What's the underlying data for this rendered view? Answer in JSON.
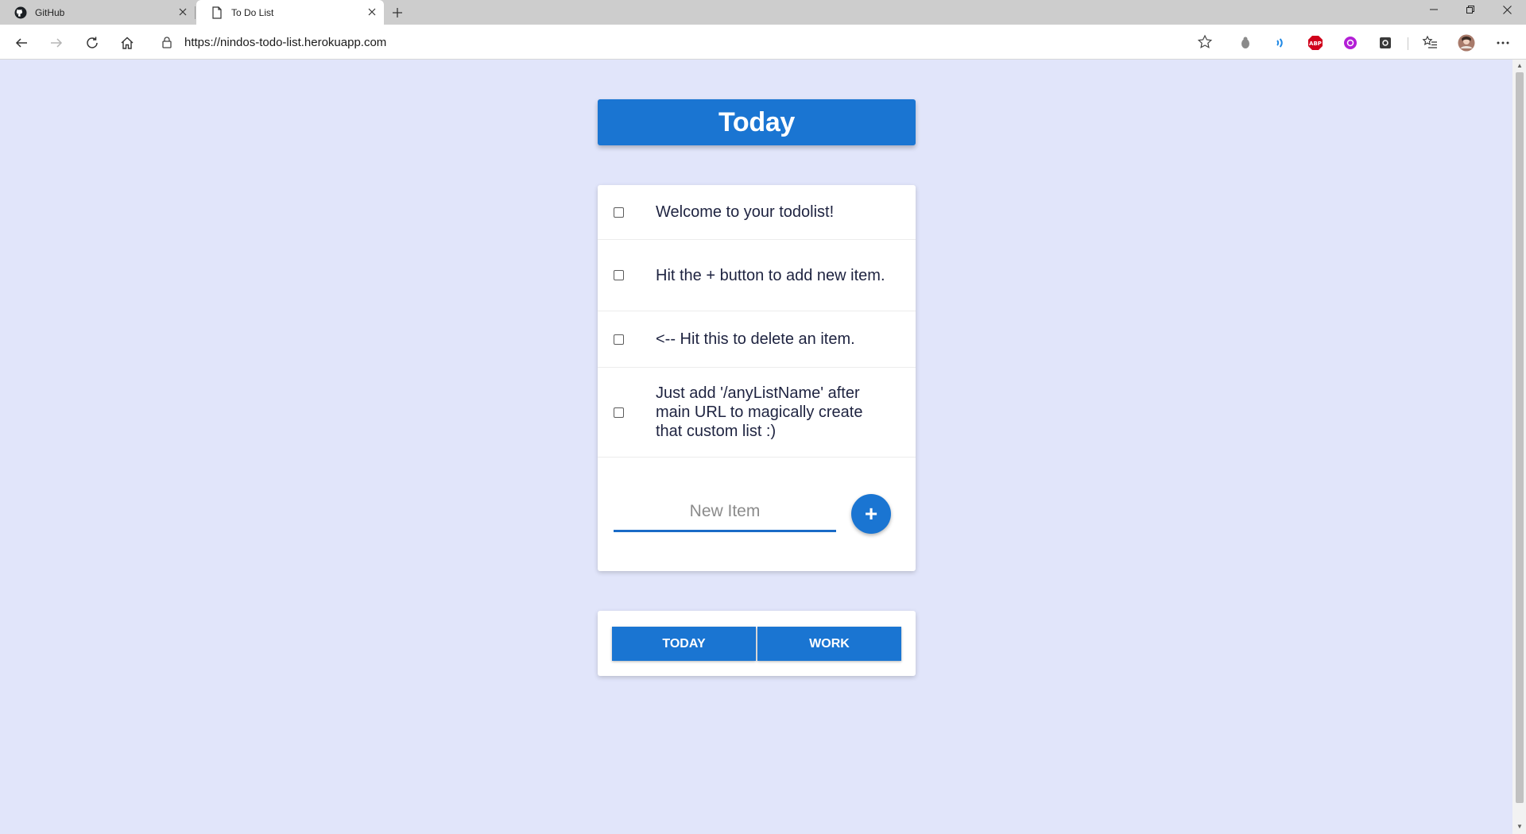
{
  "browser": {
    "tabs": [
      {
        "title": "GitHub",
        "icon": "github-icon",
        "active": false
      },
      {
        "title": "To Do List",
        "icon": "page-icon",
        "active": true
      }
    ],
    "address": "https://nindos-todo-list.herokuapp.com"
  },
  "page": {
    "heading": "Today",
    "items": [
      "Welcome to your todolist!",
      "Hit the + button to add new item.",
      "<-- Hit this to delete an item.",
      "Just add '/anyListName' after main URL to magically create that custom list :)"
    ],
    "new_item": {
      "placeholder": "New Item",
      "value": ""
    },
    "add_button": "+",
    "nav": [
      "TODAY",
      "WORK"
    ]
  },
  "colors": {
    "background": "#e1e5fa",
    "accent": "#1a75d2",
    "text": "#1e2340"
  }
}
